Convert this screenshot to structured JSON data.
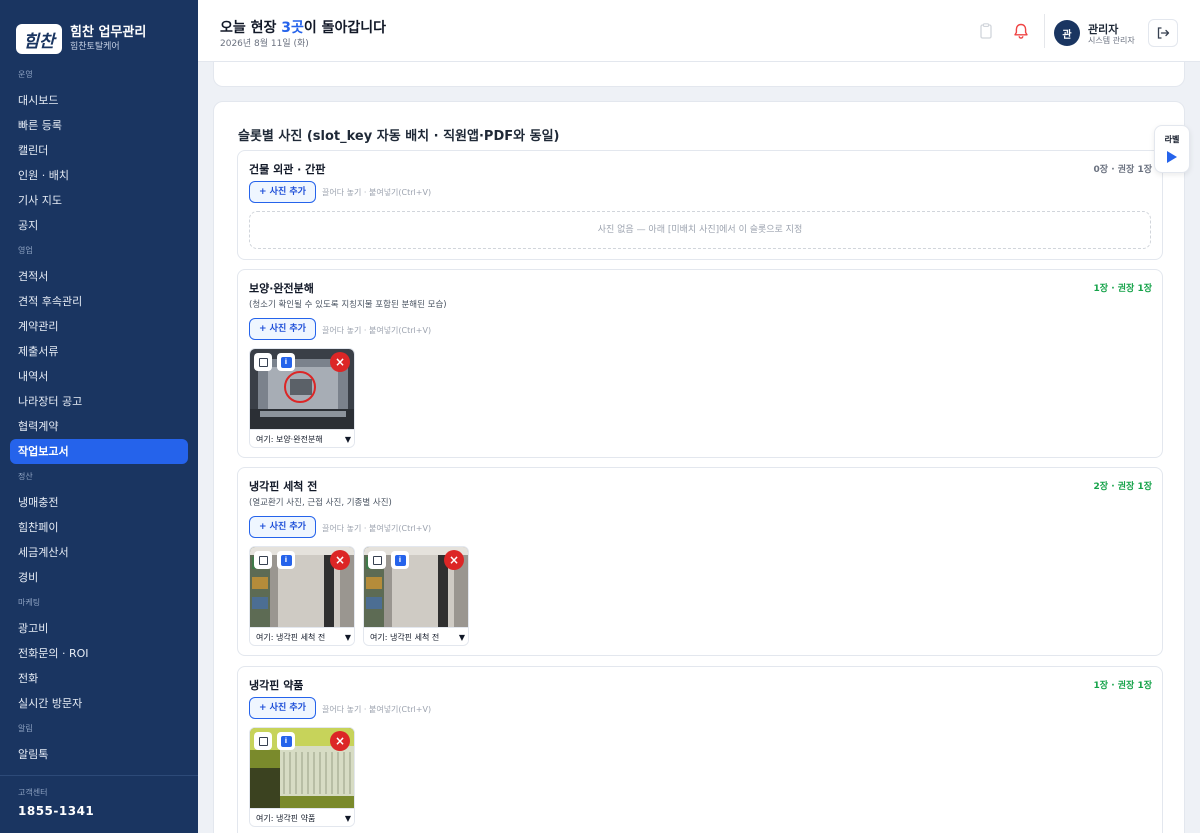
{
  "brand": {
    "logo_text": "힘찬",
    "title": "힘찬 업무관리",
    "subtitle": "힘찬토탈케어"
  },
  "sidebar": {
    "sections": [
      {
        "label": "운영",
        "items": [
          "대시보드",
          "빠른 등록",
          "캘린더",
          "인원 · 배치",
          "기사 지도",
          "공지"
        ]
      },
      {
        "label": "영업",
        "items": [
          "견적서",
          "견적 후속관리",
          "계약관리",
          "제출서류",
          "내역서",
          "나라장터 공고",
          "협력계약",
          "작업보고서"
        ]
      },
      {
        "label": "정산",
        "items": [
          "냉매충전",
          "힘찬페이",
          "세금계산서",
          "경비"
        ]
      },
      {
        "label": "마케팅",
        "items": [
          "광고비",
          "전화문의 · ROI",
          "전화",
          "실시간 방문자"
        ]
      },
      {
        "label": "알림",
        "items": [
          "알림톡"
        ]
      }
    ],
    "active_item": "작업보고서",
    "footer": {
      "label": "고객센터",
      "phone": "1855-1341"
    }
  },
  "header": {
    "title_prefix": "오늘 현장 ",
    "title_highlight": "3곳",
    "title_suffix": "이 돌아갑니다",
    "date": "2026년 8월 11일 (화)",
    "user_avatar": "관",
    "user_name": "관리자",
    "user_role": "시스템 관리자"
  },
  "panel": {
    "title": "슬롯별 사진 (slot_key 자동 배치 · 직원앱·PDF와 동일)",
    "add_label": "+ 사진 추가",
    "drop_hint": "끌어다 놓기 · 붙여넣기(Ctrl+V)",
    "slots": [
      {
        "name": "건물 외관 · 간판",
        "count": "0장 · 권장 1장",
        "empty": "사진 없음 — 아래 [미배치 사진]에서 이 슬롯으로 지정"
      },
      {
        "name": "보양·완전분해",
        "count": "1장 · 권장 1장",
        "desc": "(청소기 확인될 수 있도록 지칭지물 포함된 분해된 모습)",
        "photo_select": "여기: 보양·완전분해"
      },
      {
        "name": "냉각핀 세척 전",
        "count": "2장 · 권장 1장",
        "desc": "(열교환기 사진, 근접 사진, 기종별 사진)",
        "photo_select_1": "여기: 냉각핀 세척 전",
        "photo_select_2": "여기: 냉각핀 세척 전"
      },
      {
        "name": "냉각핀 약품",
        "count": "1장 · 권장 1장",
        "photo_select": "여기: 냉각핀 약품"
      }
    ]
  },
  "float_panel": {
    "label": "라벨"
  },
  "colors": {
    "sidebar_bg": "#1a3561",
    "accent": "#2563eb",
    "success": "#16a34a",
    "danger": "#dc2626"
  }
}
